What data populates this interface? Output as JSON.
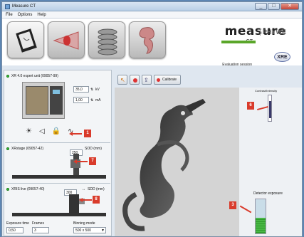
{
  "window": {
    "title": "Measure CT",
    "controls": [
      "_",
      "□",
      "✕"
    ]
  },
  "menu": [
    "File",
    "Options",
    "Help"
  ],
  "brand": {
    "name": "measure",
    "sub": "CT",
    "company": "PHYWE",
    "session": "Evaluation session",
    "badge": "XRE"
  },
  "xray_unit": {
    "title": "XR 4.0 expert unit (09057-99)",
    "voltage": "35,0",
    "voltage_unit": "kV",
    "current": "1,00",
    "current_unit": "mA"
  },
  "stage": {
    "title": "XRstage (09057-42)",
    "sdd_label": "SOD (mm)",
    "sdd_value": "250"
  },
  "detector": {
    "title": "XRIS live (09057-40)",
    "sdd_label": "SDD (mm)",
    "sdd_value": "300",
    "exposure_label": "Exposure time",
    "exposure_value": "0,50",
    "frames_label": "Frames",
    "frames_value": "3",
    "binning_label": "Binning mode",
    "binning_value": "500 x 500"
  },
  "toolbar": {
    "calibrate_label": "Calibrate"
  },
  "right_panel": {
    "contrast_label": "Contrast/Intensity",
    "exposure_label": "Detector exposure"
  },
  "annotations": [
    "1",
    "2",
    "3",
    "4",
    "5",
    "6",
    "7",
    "8"
  ],
  "colors": {
    "accent_green": "#5aa629",
    "annotation_red": "#d93b2b",
    "led_green": "#39c43a"
  },
  "exposure_level": 0.45
}
